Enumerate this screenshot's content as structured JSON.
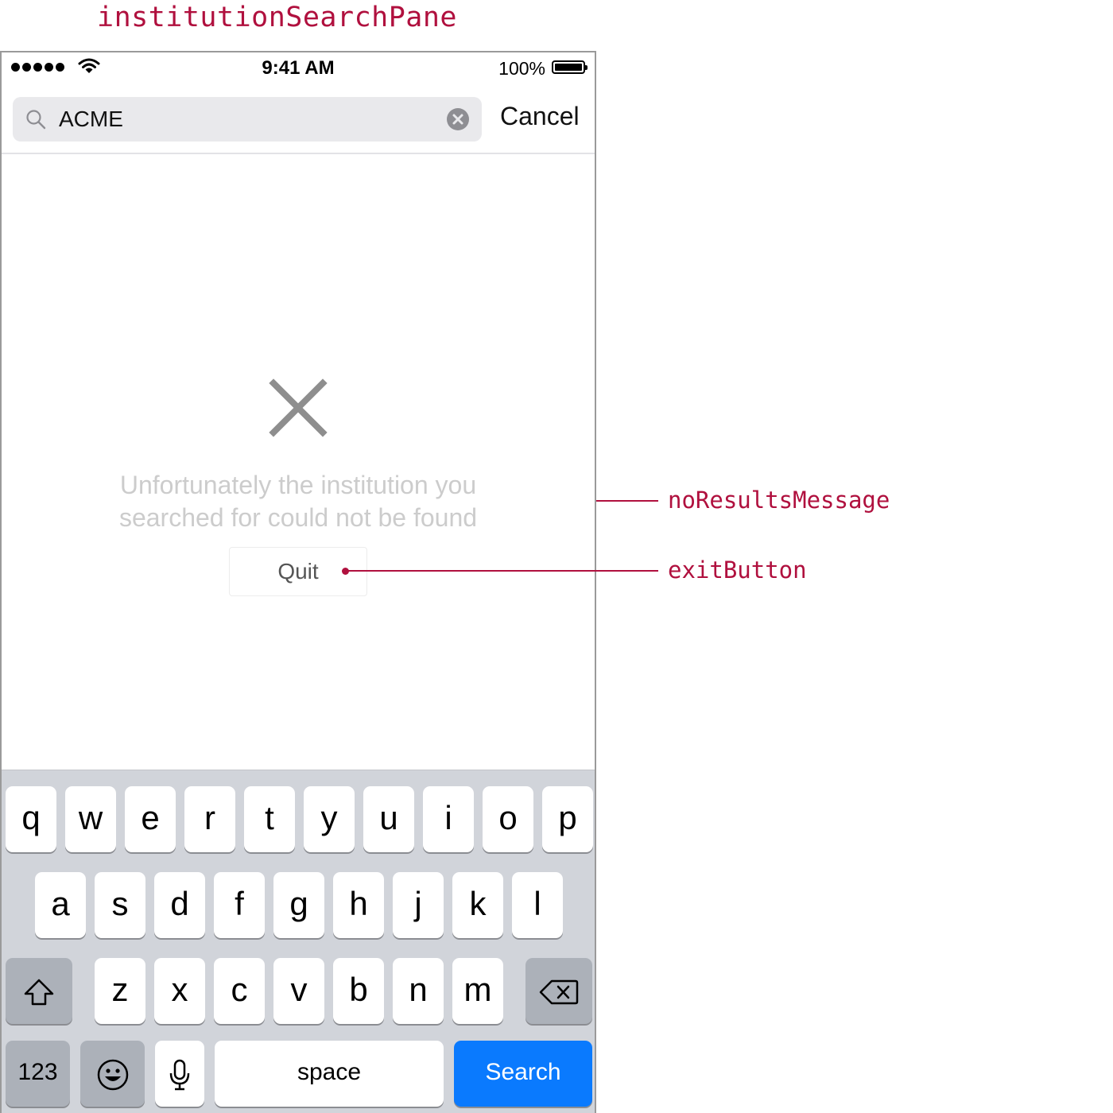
{
  "annotations": {
    "pane_title": "institutionSearchPane",
    "no_results_label": "noResultsMessage",
    "exit_button_label": "exitButton",
    "color": "#b0103e"
  },
  "status_bar": {
    "time": "9:41 AM",
    "battery": "100%",
    "signal_icon": "signal-dots-icon",
    "wifi_icon": "wifi-icon",
    "battery_icon": "battery-icon"
  },
  "search_bar": {
    "value": "ACME",
    "cancel_label": "Cancel",
    "search_icon": "magnifier-icon",
    "clear_icon": "clear-circle-icon"
  },
  "empty_state": {
    "icon": "x-mark-icon",
    "message_line1": "Unfortunately the institution you",
    "message_line2": "searched for could not be found",
    "quit_label": "Quit",
    "message_color": "#cccccc"
  },
  "keyboard": {
    "row1": [
      "q",
      "w",
      "e",
      "r",
      "t",
      "y",
      "u",
      "i",
      "o",
      "p"
    ],
    "row2": [
      "a",
      "s",
      "d",
      "f",
      "g",
      "h",
      "j",
      "k",
      "l"
    ],
    "row3": [
      "z",
      "x",
      "c",
      "v",
      "b",
      "n",
      "m"
    ],
    "numbers_label": "123",
    "space_label": "space",
    "search_label": "Search",
    "shift_icon": "shift-arrow-icon",
    "delete_icon": "backspace-icon",
    "emoji_icon": "emoji-icon",
    "mic_icon": "microphone-icon",
    "accent_color": "#0a7afe"
  }
}
